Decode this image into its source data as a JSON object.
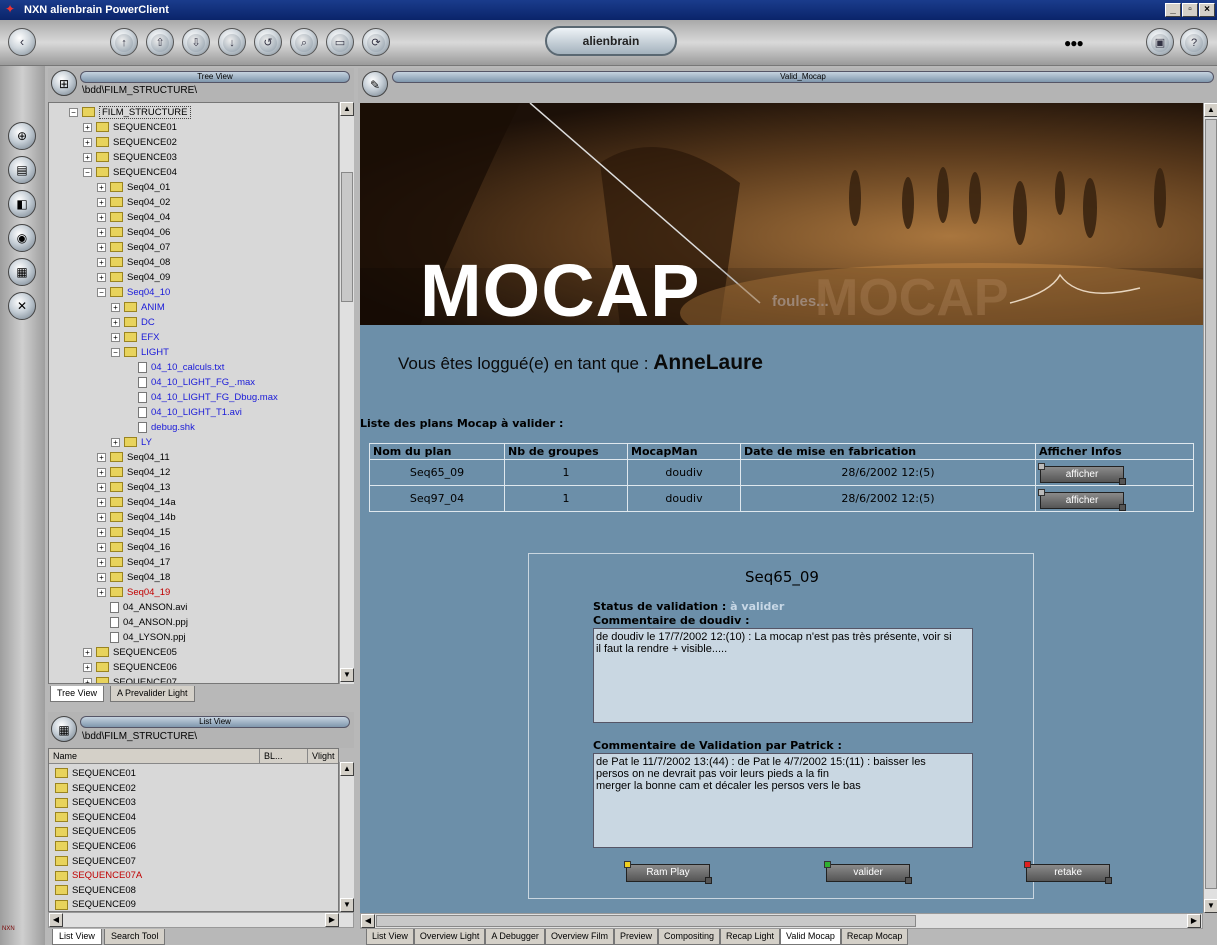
{
  "window": {
    "title": "NXN alienbrain PowerClient",
    "min": "_",
    "max": "▫",
    "close": "×"
  },
  "toolbar": {
    "logo": "alienbrain",
    "back_glyph": "‹",
    "help_glyph": "?",
    "dots": "●●●"
  },
  "tree_panel": {
    "title": "Tree View",
    "path": "\\bdd\\FILM_STRUCTURE\\",
    "tabs": [
      "Tree View",
      "A Prevalider Light"
    ],
    "items": [
      {
        "label": "FILM_STRUCTURE",
        "level": 0,
        "pm": "−",
        "type": "folder-open",
        "color": "normal"
      },
      {
        "label": "SEQUENCE01",
        "level": 1,
        "pm": "+",
        "type": "folder",
        "color": "normal"
      },
      {
        "label": "SEQUENCE02",
        "level": 1,
        "pm": "+",
        "type": "folder",
        "color": "normal"
      },
      {
        "label": "SEQUENCE03",
        "level": 1,
        "pm": "+",
        "type": "folder",
        "color": "normal"
      },
      {
        "label": "SEQUENCE04",
        "level": 1,
        "pm": "−",
        "type": "folder",
        "color": "normal"
      },
      {
        "label": "Seq04_01",
        "level": 2,
        "pm": "+",
        "type": "folder",
        "color": "normal"
      },
      {
        "label": "Seq04_02",
        "level": 2,
        "pm": "+",
        "type": "folder",
        "color": "normal"
      },
      {
        "label": "Seq04_04",
        "level": 2,
        "pm": "+",
        "type": "folder",
        "color": "normal"
      },
      {
        "label": "Seq04_06",
        "level": 2,
        "pm": "+",
        "type": "folder",
        "color": "normal"
      },
      {
        "label": "Seq04_07",
        "level": 2,
        "pm": "+",
        "type": "folder",
        "color": "normal"
      },
      {
        "label": "Seq04_08",
        "level": 2,
        "pm": "+",
        "type": "folder",
        "color": "normal"
      },
      {
        "label": "Seq04_09",
        "level": 2,
        "pm": "+",
        "type": "folder",
        "color": "normal"
      },
      {
        "label": "Seq04_10",
        "level": 2,
        "pm": "−",
        "type": "folder",
        "color": "blue"
      },
      {
        "label": "ANIM",
        "level": 3,
        "pm": "+",
        "type": "folder",
        "color": "blue"
      },
      {
        "label": "DC",
        "level": 3,
        "pm": "+",
        "type": "folder",
        "color": "blue"
      },
      {
        "label": "EFX",
        "level": 3,
        "pm": "+",
        "type": "folder",
        "color": "blue"
      },
      {
        "label": "LIGHT",
        "level": 3,
        "pm": "−",
        "type": "folder",
        "color": "blue"
      },
      {
        "label": "04_10_calculs.txt",
        "level": 4,
        "pm": "",
        "type": "file",
        "color": "blue"
      },
      {
        "label": "04_10_LIGHT_FG_.max",
        "level": 4,
        "pm": "",
        "type": "file",
        "color": "blue"
      },
      {
        "label": "04_10_LIGHT_FG_Dbug.max",
        "level": 4,
        "pm": "",
        "type": "file",
        "color": "blue"
      },
      {
        "label": "04_10_LIGHT_T1.avi",
        "level": 4,
        "pm": "",
        "type": "file",
        "color": "blue"
      },
      {
        "label": "debug.shk",
        "level": 4,
        "pm": "",
        "type": "file",
        "color": "blue"
      },
      {
        "label": "LY",
        "level": 3,
        "pm": "+",
        "type": "folder",
        "color": "blue"
      },
      {
        "label": "Seq04_11",
        "level": 2,
        "pm": "+",
        "type": "folder",
        "color": "normal"
      },
      {
        "label": "Seq04_12",
        "level": 2,
        "pm": "+",
        "type": "folder",
        "color": "normal"
      },
      {
        "label": "Seq04_13",
        "level": 2,
        "pm": "+",
        "type": "folder",
        "color": "normal"
      },
      {
        "label": "Seq04_14a",
        "level": 2,
        "pm": "+",
        "type": "folder",
        "color": "normal"
      },
      {
        "label": "Seq04_14b",
        "level": 2,
        "pm": "+",
        "type": "folder",
        "color": "normal"
      },
      {
        "label": "Seq04_15",
        "level": 2,
        "pm": "+",
        "type": "folder",
        "color": "normal"
      },
      {
        "label": "Seq04_16",
        "level": 2,
        "pm": "+",
        "type": "folder",
        "color": "normal"
      },
      {
        "label": "Seq04_17",
        "level": 2,
        "pm": "+",
        "type": "folder",
        "color": "normal"
      },
      {
        "label": "Seq04_18",
        "level": 2,
        "pm": "+",
        "type": "folder",
        "color": "normal"
      },
      {
        "label": "Seq04_19",
        "level": 2,
        "pm": "+",
        "type": "folder",
        "color": "red"
      },
      {
        "label": "04_ANSON.avi",
        "level": 2,
        "pm": "",
        "type": "file",
        "color": "normal"
      },
      {
        "label": "04_ANSON.ppj",
        "level": 2,
        "pm": "",
        "type": "file",
        "color": "normal"
      },
      {
        "label": "04_LYSON.ppj",
        "level": 2,
        "pm": "",
        "type": "file",
        "color": "normal"
      },
      {
        "label": "SEQUENCE05",
        "level": 1,
        "pm": "+",
        "type": "folder",
        "color": "normal"
      },
      {
        "label": "SEQUENCE06",
        "level": 1,
        "pm": "+",
        "type": "folder",
        "color": "normal"
      },
      {
        "label": "SEQUENCE07",
        "level": 1,
        "pm": "+",
        "type": "folder",
        "color": "normal"
      }
    ]
  },
  "list_panel": {
    "title": "List View",
    "path": "\\bdd\\FILM_STRUCTURE\\",
    "columns": [
      "Name",
      "BL...",
      "Vlight"
    ],
    "tabs": [
      "List View",
      "Search Tool"
    ],
    "items": [
      {
        "label": "SEQUENCE01",
        "color": "normal"
      },
      {
        "label": "SEQUENCE02",
        "color": "normal"
      },
      {
        "label": "SEQUENCE03",
        "color": "normal"
      },
      {
        "label": "SEQUENCE04",
        "color": "normal"
      },
      {
        "label": "SEQUENCE05",
        "color": "normal"
      },
      {
        "label": "SEQUENCE06",
        "color": "normal"
      },
      {
        "label": "SEQUENCE07",
        "color": "normal"
      },
      {
        "label": "SEQUENCE07A",
        "color": "red"
      },
      {
        "label": "SEQUENCE08",
        "color": "normal"
      },
      {
        "label": "SEQUENCE09",
        "color": "normal"
      }
    ]
  },
  "content_panel": {
    "title": "Valid_Mocap"
  },
  "banner": {
    "title": "MOCAP",
    "subtitle": "foules...",
    "ghost": "MOCAP"
  },
  "login": {
    "prefix": "Vous êtes loggué(e) en tant que : ",
    "user": "AnneLaure"
  },
  "list_title": "Liste des plans Mocap à valider :",
  "plans_table": {
    "headers": [
      "Nom du plan",
      "Nb de groupes",
      "MocapMan",
      "Date de mise en fabrication",
      "Afficher Infos"
    ],
    "rows": [
      {
        "plan": "Seq65_09",
        "groups": "1",
        "man": "doudiv",
        "date": "28/6/2002 12:(5)",
        "action": "afficher"
      },
      {
        "plan": "Seq97_04",
        "groups": "1",
        "man": "doudiv",
        "date": "28/6/2002 12:(5)",
        "action": "afficher"
      }
    ]
  },
  "detail": {
    "plan": "Seq65_09",
    "status_label": "Status de validation : ",
    "status_value": "à valider",
    "comment_label": "Commentaire de doudiv :",
    "comment": "de doudiv le 17/7/2002 12:(10) : La mocap n'est pas très présente, voir si il faut la rendre + visible.....",
    "validation_label": "Commentaire de Validation par Patrick :",
    "validation_comment": "de Pat le 11/7/2002 13:(44) : de Pat le 4/7/2002 15:(11) : baisser les persos on ne devrait pas voir leurs pieds a la fin\nmerger la bonne cam et décaler les persos vers le bas",
    "buttons": [
      "Ram Play",
      "valider",
      "retake"
    ]
  },
  "bottom_tabs": [
    "List View",
    "Overview Light",
    "A Debugger",
    "Overview Film",
    "Preview",
    "Compositing",
    "Recap Light",
    "Valid Mocap",
    "Recap Mocap"
  ],
  "colors": {
    "content_bg": "#6c8fa9",
    "tree_blue": "#1a1ad8",
    "tree_red": "#c00000",
    "status_value": "#c8d8e6",
    "led_yellow": "#f0d020",
    "led_green": "#30b030",
    "led_red": "#e02020"
  },
  "nxn_label": "NXN"
}
